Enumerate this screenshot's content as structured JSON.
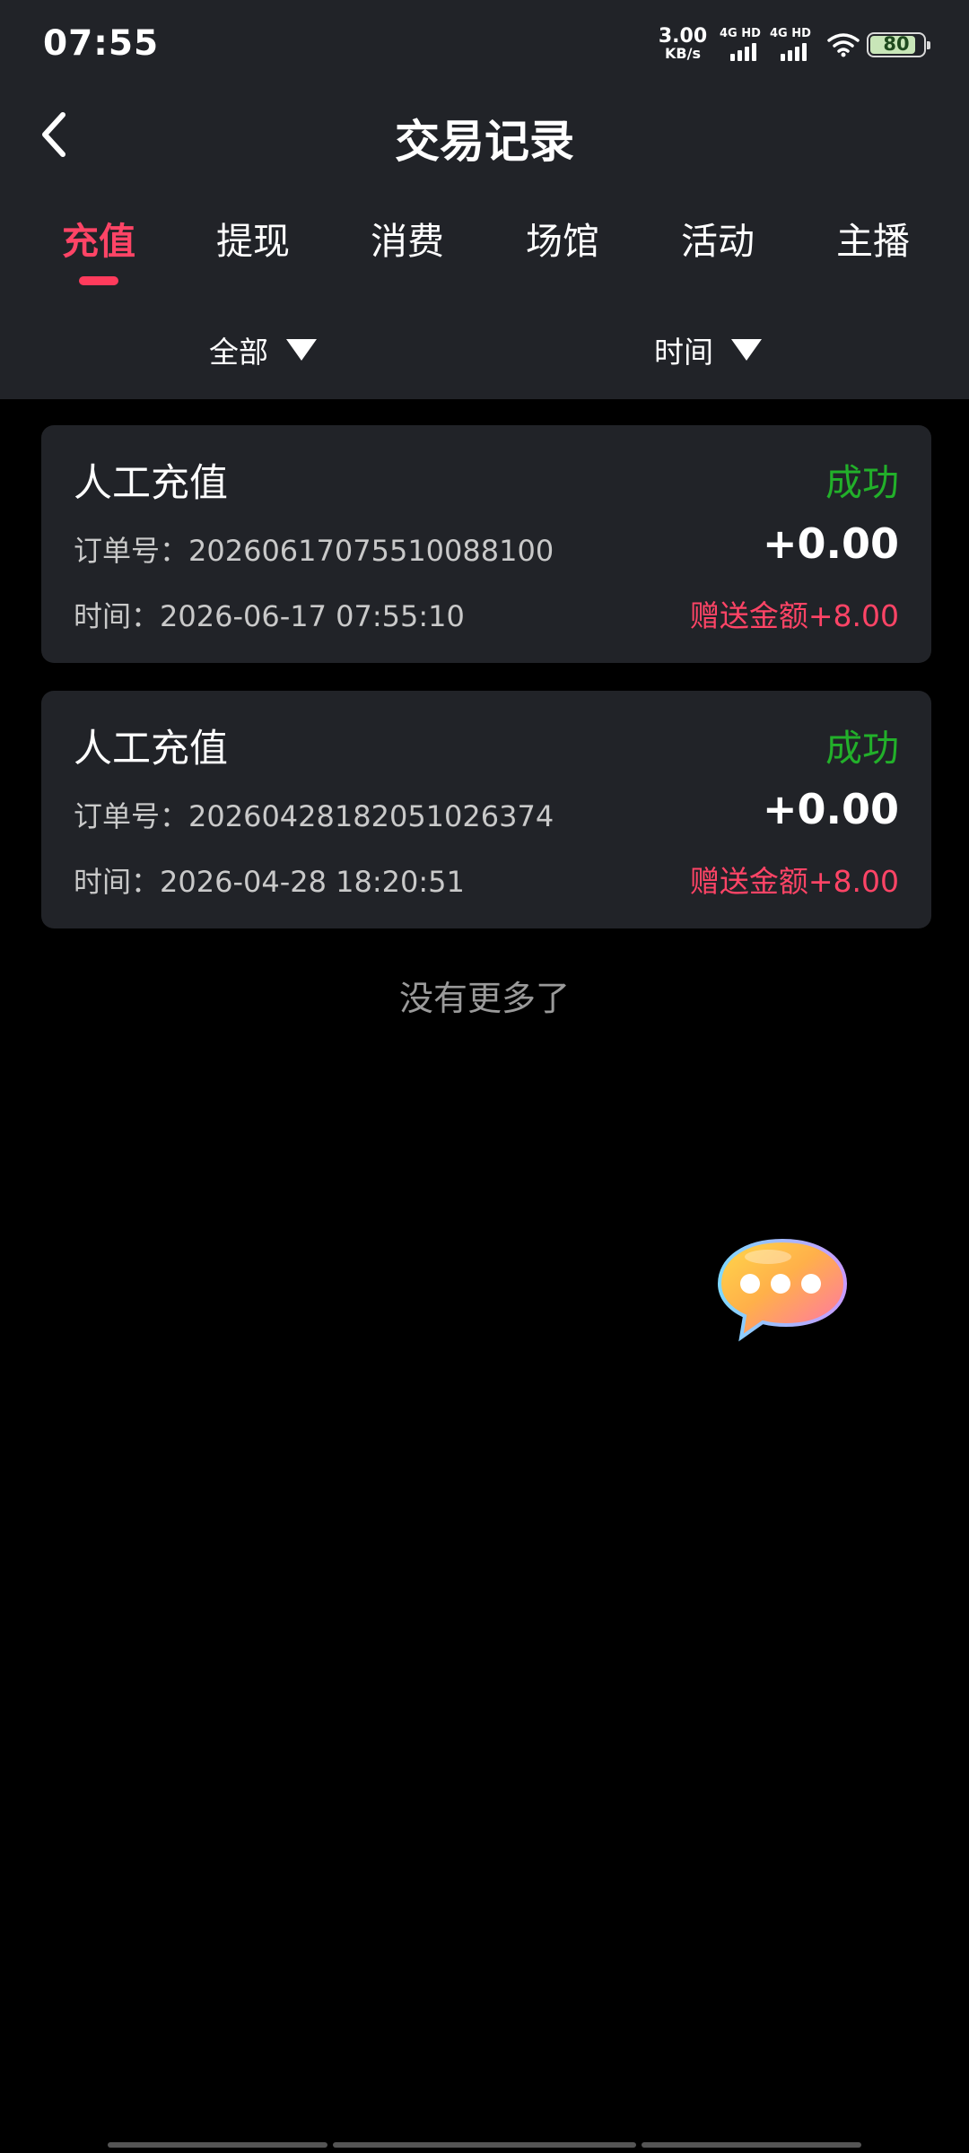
{
  "status_bar": {
    "time": "07:55",
    "net_speed_value": "3.00",
    "net_speed_unit": "KB/s",
    "sim1_label": "4G HD",
    "sim2_label": "4G HD",
    "battery_level": "80"
  },
  "header": {
    "title": "交易记录"
  },
  "tabs": [
    {
      "label": "充值",
      "active": true
    },
    {
      "label": "提现",
      "active": false
    },
    {
      "label": "消费",
      "active": false
    },
    {
      "label": "场馆",
      "active": false
    },
    {
      "label": "活动",
      "active": false
    },
    {
      "label": "主播",
      "active": false
    }
  ],
  "filters": {
    "type_label": "全部",
    "time_label": "时间"
  },
  "records": [
    {
      "type": "人工充值",
      "status": "成功",
      "order": "订单号：20260617075510088100",
      "amount": "+0.00",
      "time": "时间：2026-06-17 07:55:10",
      "bonus": "赠送金额+8.00"
    },
    {
      "type": "人工充值",
      "status": "成功",
      "order": "订单号：20260428182051026374",
      "amount": "+0.00",
      "time": "时间：2026-04-28 18:20:51",
      "bonus": "赠送金额+8.00"
    }
  ],
  "footer_text": "没有更多了",
  "colors": {
    "accent": "#ff3b5c",
    "success": "#22b02a",
    "header_bg": "#212328",
    "card_bg": "#212328",
    "page_bg": "#000000"
  },
  "icons": {
    "back": "chevron-left-icon",
    "filter_arrow": "triangle-down-icon",
    "chat": "chat-bubble-icon"
  }
}
